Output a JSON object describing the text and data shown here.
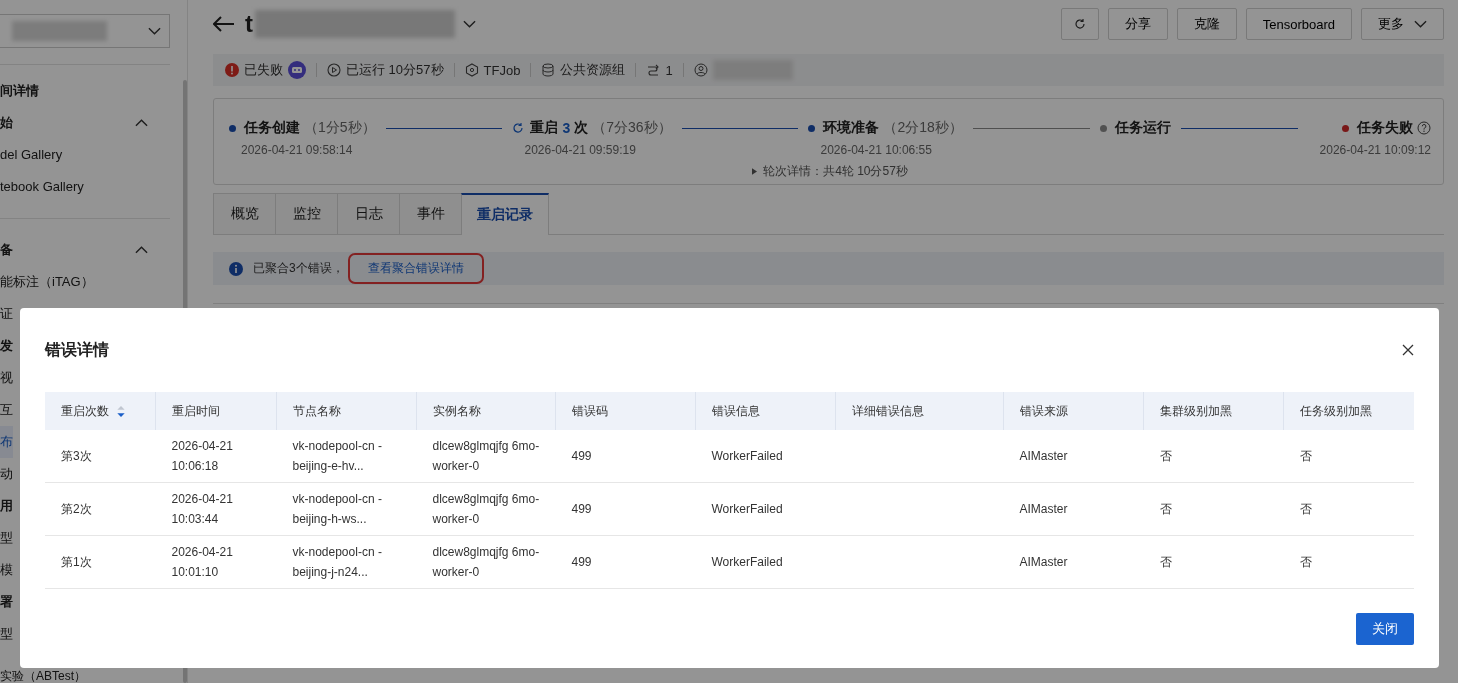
{
  "sidebar": {
    "items": [
      {
        "kind": "heading",
        "label": "间详情"
      },
      {
        "kind": "group",
        "label": "始",
        "expanded": true
      },
      {
        "kind": "item",
        "label": "del Gallery",
        "selected": false
      },
      {
        "kind": "item",
        "label": "tebook Gallery",
        "selected": false
      },
      {
        "kind": "divider"
      },
      {
        "kind": "group",
        "label": "备",
        "expanded": true
      },
      {
        "kind": "item",
        "label": "能标注（iTAG）",
        "selected": false
      },
      {
        "kind": "item",
        "label": "证",
        "selected": false
      },
      {
        "kind": "heading",
        "label": "发"
      },
      {
        "kind": "item",
        "label": "视",
        "selected": false
      },
      {
        "kind": "item",
        "label": "互",
        "selected": false
      },
      {
        "kind": "item",
        "label": "布",
        "selected": true
      },
      {
        "kind": "item",
        "label": "动",
        "selected": false
      },
      {
        "kind": "heading",
        "label": "用"
      },
      {
        "kind": "item",
        "label": "型",
        "selected": false
      },
      {
        "kind": "item",
        "label": "模",
        "selected": false
      },
      {
        "kind": "heading",
        "label": "署"
      },
      {
        "kind": "item",
        "label": "型",
        "selected": false
      },
      {
        "kind": "item",
        "label": "实验（ABTest）",
        "selected": false
      }
    ]
  },
  "header": {
    "title": "t",
    "buttons": [
      {
        "kind": "icon"
      },
      {
        "kind": "text",
        "label": "分享"
      },
      {
        "kind": "text",
        "label": "克隆"
      },
      {
        "kind": "text",
        "label": "Tensorboard"
      },
      {
        "kind": "menu",
        "label": "更多"
      }
    ]
  },
  "meta": [
    {
      "kind": "status",
      "label": "已失败"
    },
    {
      "kind": "runtime",
      "label": "已运行 10分57秒"
    },
    {
      "kind": "framework",
      "label": "TFJob"
    },
    {
      "kind": "resource",
      "label": "公共资源组"
    },
    {
      "kind": "nodes",
      "label": "1"
    },
    {
      "kind": "user"
    }
  ],
  "steps": [
    {
      "kind": "done",
      "label": "任务创建",
      "duration": "（1分5秒）",
      "time": "2026-04-21 09:58:14"
    },
    {
      "kind": "restart",
      "label": "重启",
      "count": "3",
      "suffix": "次",
      "duration": "（7分36秒）",
      "time": "2026-04-21 09:59:19",
      "line_active": true
    },
    {
      "kind": "done",
      "label": "环境准备",
      "duration": "（2分18秒）",
      "time": "2026-04-21 10:06:55",
      "line_active": true
    },
    {
      "kind": "pending",
      "label": "任务运行",
      "line_active": false
    },
    {
      "kind": "failed",
      "label": "任务失败",
      "time": "2026-04-21 10:09:12",
      "line_active": true
    }
  ],
  "rounds": "轮次详情：共4轮 10分57秒",
  "tabs": [
    {
      "label": "概览",
      "selected": false
    },
    {
      "label": "监控",
      "selected": false
    },
    {
      "label": "日志",
      "selected": false
    },
    {
      "label": "事件",
      "selected": false
    },
    {
      "label": "重启记录",
      "selected": true
    }
  ],
  "alert": {
    "text": "已聚合3个错误，",
    "link": "查看聚合错误详情"
  },
  "dialog": {
    "title": "错误详情",
    "columns": [
      {
        "label": "重启次数",
        "sortable": true
      },
      {
        "label": "重启时间"
      },
      {
        "label": "节点名称"
      },
      {
        "label": "实例名称"
      },
      {
        "label": "错误码"
      },
      {
        "label": "错误信息"
      },
      {
        "label": "详细错误信息"
      },
      {
        "label": "错误来源"
      },
      {
        "label": "集群级别加黑"
      },
      {
        "label": "任务级别加黑"
      }
    ],
    "rows": [
      [
        "第3次",
        "2026-04-21 10:06:18",
        "vk-nodepool-cn -beijing-e-hv...",
        "dlcew8glmqjfg 6mo-worker-0",
        "499",
        "WorkerFailed",
        "",
        "AIMaster",
        "否",
        "否"
      ],
      [
        "第2次",
        "2026-04-21 10:03:44",
        "vk-nodepool-cn -beijing-h-ws...",
        "dlcew8glmqjfg 6mo-worker-0",
        "499",
        "WorkerFailed",
        "",
        "AIMaster",
        "否",
        "否"
      ],
      [
        "第1次",
        "2026-04-21 10:01:10",
        "vk-nodepool-cn -beijing-j-n24...",
        "dlcew8glmqjfg 6mo-worker-0",
        "499",
        "WorkerFailed",
        "",
        "AIMaster",
        "否",
        "否"
      ]
    ],
    "button": "关闭"
  }
}
